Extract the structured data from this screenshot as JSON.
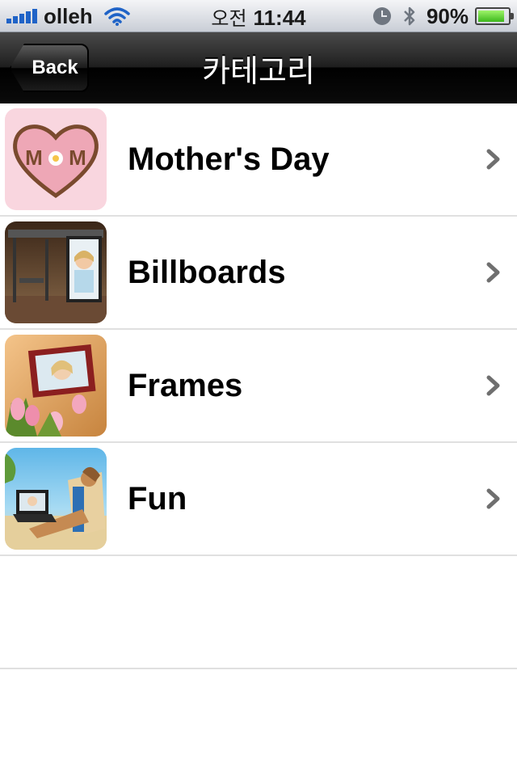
{
  "status_bar": {
    "carrier": "olleh",
    "ampm": "오전",
    "time": "11:44",
    "battery_percent": "90%",
    "battery_level": 0.9,
    "icons": [
      "signal-icon",
      "wifi-icon",
      "clock-icon",
      "bluetooth-icon",
      "battery-icon"
    ]
  },
  "nav": {
    "back_label": "Back",
    "title": "카테고리"
  },
  "categories": [
    {
      "label": "Mother's Day",
      "thumb": "mothers-day-thumbnail"
    },
    {
      "label": "Billboards",
      "thumb": "billboards-thumbnail"
    },
    {
      "label": "Frames",
      "thumb": "frames-thumbnail"
    },
    {
      "label": "Fun",
      "thumb": "fun-thumbnail"
    }
  ],
  "colors": {
    "signal_blue": "#1f63c7",
    "nav_black": "#000000",
    "separator": "#e0e0e0",
    "chevron": "#6f6f6f"
  }
}
